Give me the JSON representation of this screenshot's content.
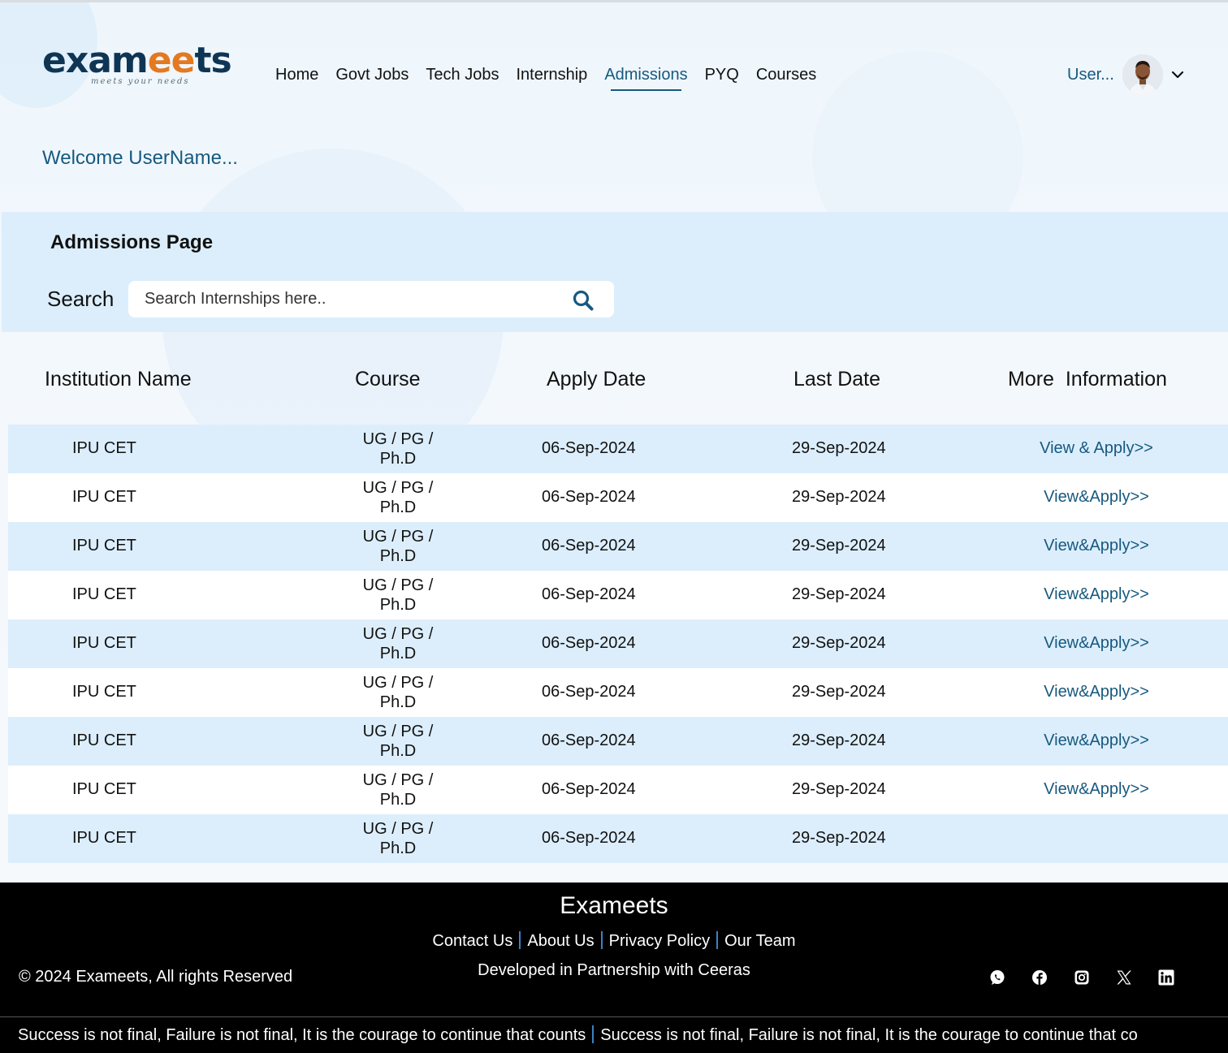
{
  "brand": {
    "logo_part1": "ex",
    "logo_part2": "am",
    "logo_part3": "ee",
    "logo_part4": "ts",
    "tagline": "meets your needs"
  },
  "nav": {
    "items": [
      {
        "label": "Home"
      },
      {
        "label": "Govt Jobs"
      },
      {
        "label": "Tech Jobs"
      },
      {
        "label": "Internship"
      },
      {
        "label": "Admissions",
        "active": true
      },
      {
        "label": "PYQ"
      },
      {
        "label": "Courses"
      }
    ]
  },
  "user": {
    "name": "User..."
  },
  "welcome": "Welcome UserName...",
  "page": {
    "title": "Admissions Page",
    "search_label": "Search",
    "search_placeholder": "Search Internships here.."
  },
  "table": {
    "headers": {
      "institution": "Institution Name",
      "course": "Course",
      "apply_date": "Apply Date",
      "last_date": "Last Date",
      "more_info": "More  Information"
    },
    "rows": [
      {
        "institution": "IPU CET",
        "course_line1": "UG / PG /",
        "course_line2": "Ph.D",
        "apply_date": "06-Sep-2024",
        "last_date": "29-Sep-2024",
        "more": "View & Apply>>"
      },
      {
        "institution": "IPU CET",
        "course_line1": "UG / PG /",
        "course_line2": "Ph.D",
        "apply_date": "06-Sep-2024",
        "last_date": "29-Sep-2024",
        "more": "View&Apply>>"
      },
      {
        "institution": "IPU CET",
        "course_line1": "UG / PG /",
        "course_line2": "Ph.D",
        "apply_date": "06-Sep-2024",
        "last_date": "29-Sep-2024",
        "more": "View&Apply>>"
      },
      {
        "institution": "IPU CET",
        "course_line1": "UG / PG /",
        "course_line2": "Ph.D",
        "apply_date": "06-Sep-2024",
        "last_date": "29-Sep-2024",
        "more": "View&Apply>>"
      },
      {
        "institution": "IPU CET",
        "course_line1": "UG / PG /",
        "course_line2": "Ph.D",
        "apply_date": "06-Sep-2024",
        "last_date": "29-Sep-2024",
        "more": "View&Apply>>"
      },
      {
        "institution": "IPU CET",
        "course_line1": "UG / PG /",
        "course_line2": "Ph.D",
        "apply_date": "06-Sep-2024",
        "last_date": "29-Sep-2024",
        "more": "View&Apply>>"
      },
      {
        "institution": "IPU CET",
        "course_line1": "UG / PG /",
        "course_line2": "Ph.D",
        "apply_date": "06-Sep-2024",
        "last_date": "29-Sep-2024",
        "more": "View&Apply>>"
      },
      {
        "institution": "IPU CET",
        "course_line1": "UG / PG /",
        "course_line2": "Ph.D",
        "apply_date": "06-Sep-2024",
        "last_date": "29-Sep-2024",
        "more": "View&Apply>>"
      },
      {
        "institution": "IPU CET",
        "course_line1": "UG / PG /",
        "course_line2": "Ph.D",
        "apply_date": "06-Sep-2024",
        "last_date": "29-Sep-2024",
        "more": ""
      }
    ]
  },
  "footer": {
    "title": "Exameets",
    "links": [
      "Contact Us",
      "About Us",
      "Privacy Policy",
      "Our Team"
    ],
    "developed": "Developed in Partnership with Ceeras",
    "copyright": "© 2024 Exameets, All rights Reserved",
    "socials": [
      "whatsapp-icon",
      "facebook-icon",
      "instagram-icon",
      "x-icon",
      "linkedin-icon"
    ],
    "ticker_text": "Success is not final, Failure is not final, It is the courage to continue that counts",
    "ticker_text2": "Success is not final, Failure is not final, It is the courage to continue that co"
  },
  "colors": {
    "accent": "#17597f",
    "band": "#dceefc",
    "logo_dark": "#0f3554",
    "logo_orange": "#e4791f",
    "footer_bg": "#000000"
  }
}
